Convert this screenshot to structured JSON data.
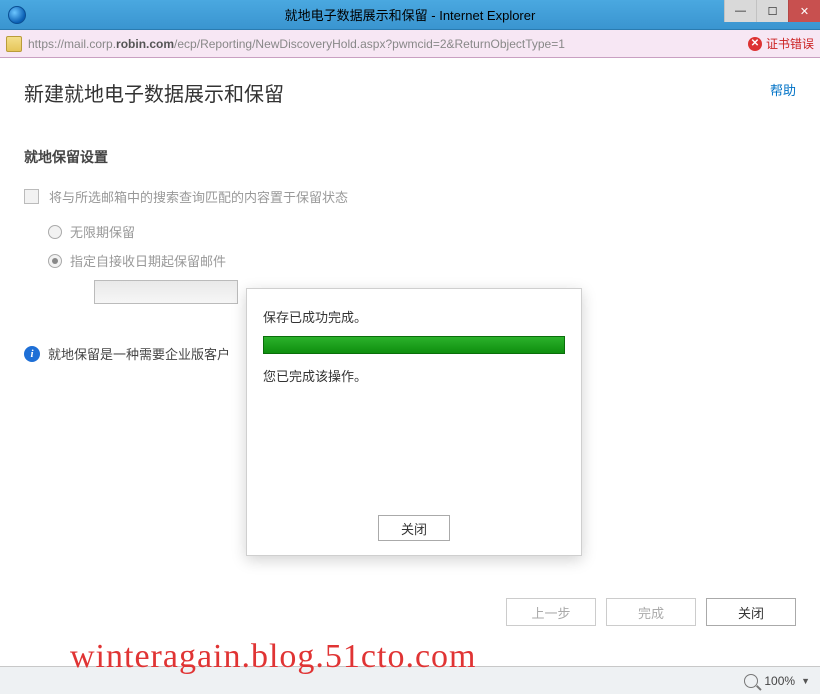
{
  "window": {
    "title": "就地电子数据展示和保留 - Internet Explorer"
  },
  "addressbar": {
    "url_prefix": "https://mail.corp.",
    "url_host": "robin.com",
    "url_suffix": "/ecp/Reporting/NewDiscoveryHold.aspx?pwmcid=2&ReturnObjectType=1",
    "cert_error": "证书错误"
  },
  "page": {
    "help": "帮助",
    "heading": "新建就地电子数据展示和保留",
    "section": "就地保留设置",
    "checkbox_label": "将与所选邮箱中的搜索查询匹配的内容置于保留状态",
    "radio1": "无限期保留",
    "radio2": "指定自接收日期起保留邮件",
    "info": "就地保留是一种需要企业版客户",
    "btn_prev": "上一步",
    "btn_finish": "完成",
    "btn_close": "关闭"
  },
  "modal": {
    "msg1": "保存已成功完成。",
    "msg2": "您已完成该操作。",
    "btn_close": "关闭"
  },
  "statusbar": {
    "zoom": "100%"
  },
  "watermark": "winteragain.blog.51cto.com"
}
